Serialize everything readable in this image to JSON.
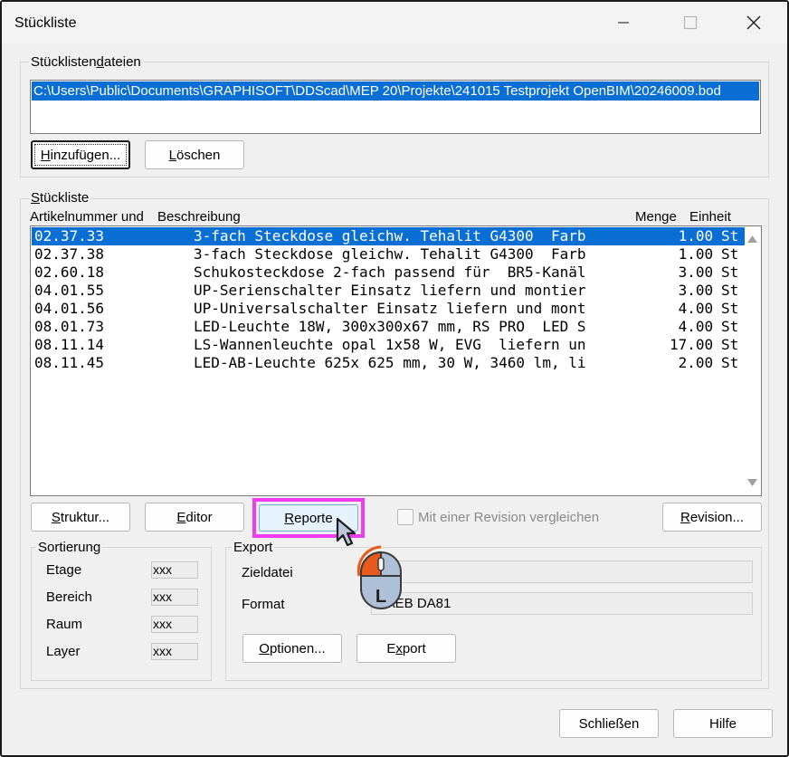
{
  "window": {
    "title": "Stückliste",
    "minimize_icon": "minimize-icon",
    "maximize_icon": "maximize-icon",
    "close_icon": "close-icon"
  },
  "files_group": {
    "label_pre": "Stücklisten",
    "label_mnemonic": "d",
    "label_post": "ateien",
    "selected_file": "C:\\Users\\Public\\Documents\\GRAPHISOFT\\DDScad\\MEP 20\\Projekte\\241015 Testprojekt OpenBIM\\20246009.bod",
    "add_button": {
      "mnemonic": "H",
      "rest": "inzufügen..."
    },
    "delete_button": {
      "mnemonic": "L",
      "rest": "öschen"
    }
  },
  "bom_group": {
    "label_mnemonic": "S",
    "label_rest": "tückliste",
    "columns": {
      "article": "Artikelnummer und",
      "description": "Beschreibung",
      "quantity": "Menge",
      "unit": "Einheit"
    },
    "rows": [
      {
        "article": "02.37.33",
        "description": "3-fach Steckdose gleichw. Tehalit G4300  Farb",
        "quantity": " 1.00",
        "unit": "St",
        "selected": true
      },
      {
        "article": "02.37.38",
        "description": "3-fach Steckdose gleichw. Tehalit G4300  Farb",
        "quantity": " 1.00",
        "unit": "St",
        "selected": false
      },
      {
        "article": "02.60.18",
        "description": "Schukosteckdose 2-fach passend für  BR5-Kanäl",
        "quantity": " 3.00",
        "unit": "St",
        "selected": false
      },
      {
        "article": "04.01.55",
        "description": "UP-Serienschalter Einsatz liefern und montier",
        "quantity": " 3.00",
        "unit": "St",
        "selected": false
      },
      {
        "article": "04.01.56",
        "description": "UP-Universalschalter Einsatz liefern und mont",
        "quantity": " 4.00",
        "unit": "St",
        "selected": false
      },
      {
        "article": "08.01.73",
        "description": "LED-Leuchte 18W, 300x300x67 mm, RS PRO  LED S",
        "quantity": " 4.00",
        "unit": "St",
        "selected": false
      },
      {
        "article": "08.11.14",
        "description": "LS-Wannenleuchte opal 1x58 W, EVG  liefern un",
        "quantity": "17.00",
        "unit": "St",
        "selected": false
      },
      {
        "article": "08.11.45",
        "description": "LED-AB-Leuchte 625x 625 mm, 30 W, 3460 lm, li",
        "quantity": " 2.00",
        "unit": "St",
        "selected": false
      }
    ],
    "structure_button": {
      "mnemonic": "S",
      "rest": "truktur..."
    },
    "editor_button": {
      "mnemonic": "E",
      "rest": "ditor"
    },
    "reports_button": {
      "mnemonic": "R",
      "rest": "eporte"
    },
    "compare_checkbox_label": "Mit einer Revision vergleichen",
    "compare_checked": false,
    "revision_button": {
      "mnemonic": "R",
      "rest": "evision..."
    }
  },
  "sorting_group": {
    "label": "Sortierung",
    "fields": [
      {
        "label": "Etage",
        "value": "xxx"
      },
      {
        "label": "Bereich",
        "value": "xxx"
      },
      {
        "label": "Raum",
        "value": "xxx"
      },
      {
        "label": "Layer",
        "value": "xxx"
      }
    ]
  },
  "export_group": {
    "label": "Export",
    "target_label": "Zieldatei",
    "target_value": "",
    "format_label": "Format",
    "format_value": "GAEB DA81",
    "options_button": {
      "mnemonic": "O",
      "rest": "ptionen..."
    },
    "export_button": {
      "mnemonic": "x",
      "pre": "E",
      "rest": "port"
    }
  },
  "footer": {
    "close_label": "Schließen",
    "help_label": "Hilfe"
  },
  "overlay": {
    "mouse_button_letter": "L",
    "highlight_color": "#f03cf0",
    "mouse_accent_color": "#e85a1b"
  }
}
